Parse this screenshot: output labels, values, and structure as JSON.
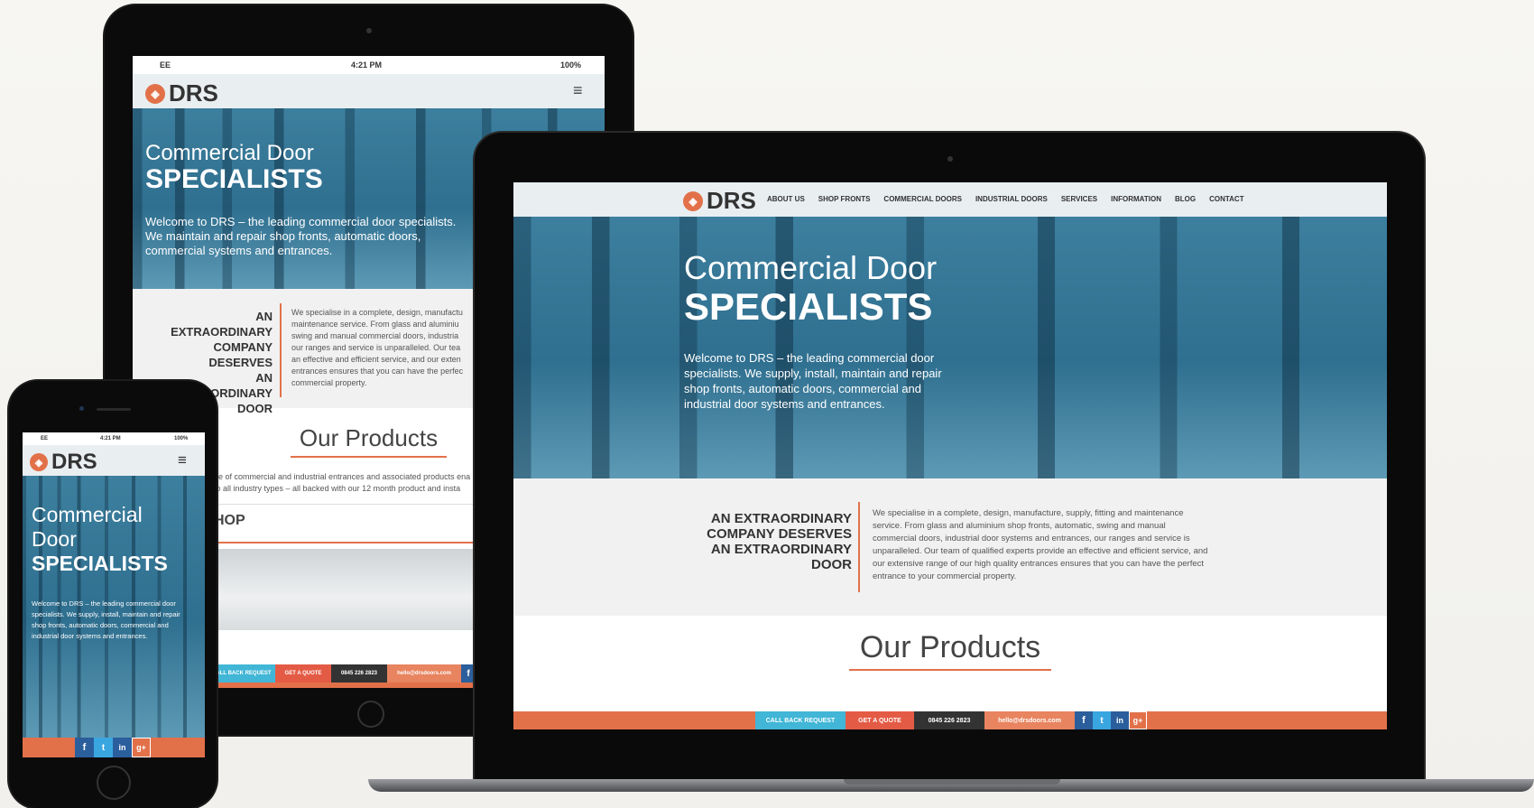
{
  "colors": {
    "accent": "#e2714a",
    "cta_blue": "#41b6d6",
    "cta_red": "#e45b45",
    "cta_dark": "#333333",
    "social_blue": "#2b5e9c",
    "twitter": "#3aa6e0"
  },
  "brand": {
    "name": "DRS"
  },
  "status": {
    "carrier": "EE",
    "time": "4:21 PM",
    "battery": "100%"
  },
  "nav": [
    "ABOUT US",
    "SHOP FRONTS",
    "COMMERCIAL DOORS",
    "INDUSTRIAL DOORS",
    "SERVICES",
    "INFORMATION",
    "BLOG",
    "CONTACT"
  ],
  "hero": {
    "line1": "Commercial Door",
    "line1_a": "Commercial",
    "line1_b": "Door",
    "line2": "SPECIALISTS",
    "text": "Welcome to DRS – the leading commercial door specialists. We supply, install, maintain and repair shop fronts, automatic doors, commercial and industrial door systems and entrances.",
    "tablet_text": "Welcome to DRS – the leading commercial door specialists. We maintain and repair shop fronts, automatic doors, commercial systems and entrances."
  },
  "intro": {
    "heading_lines": [
      "AN EXTRAORDINARY",
      "COMPANY DESERVES",
      "AN EXTRAORDINARY",
      "DOOR"
    ],
    "text": "We specialise in a complete, design, manufacture, supply, fitting and maintenance service. From glass and aluminium shop fronts, automatic, swing and manual commercial doors, industrial door systems and entrances, our ranges and service is unparalleled. Our team of qualified experts provide an effective and efficient service, and our extensive range of our high quality entrances ensures that you can have the perfect entrance to your commercial property.",
    "tablet_text": "We specialise in a complete, design, manufactu maintenance service. From glass and aluminiu swing and manual commercial doors, industria our ranges and service is unparalleled. Our tea an effective and efficient service, and our exten entrances ensures that you can have the perfec commercial property."
  },
  "products": {
    "heading": "Our Products",
    "tablet_text": "ge of commercial and industrial entrances and associated products ena e to all industry types – all backed with our 12 month product and insta",
    "tablet_sub": "HOP"
  },
  "cta": {
    "callback": "CALL BACK REQUEST",
    "tablet_callback": "ALL BACK REQUEST",
    "quote": "GET A QUOTE",
    "phone": "0845 226 2823",
    "email": "hello@drsdoors.com"
  },
  "social": {
    "facebook": "f",
    "twitter": "t",
    "linkedin": "in",
    "google": "g+"
  },
  "menu_icon": "hamburger-icon"
}
